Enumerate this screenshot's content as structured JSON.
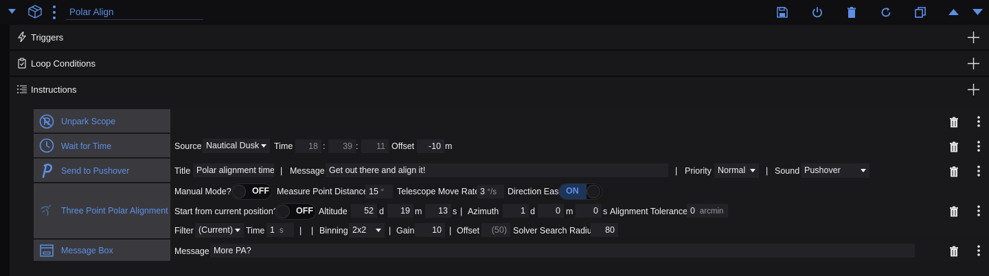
{
  "header": {
    "title": "Polar Align"
  },
  "sections": {
    "triggers": "Triggers",
    "loop_conditions": "Loop Conditions",
    "instructions": "Instructions"
  },
  "items": {
    "unpark": {
      "label": "Unpark Scope"
    },
    "wait": {
      "label": "Wait for Time",
      "source_label": "Source",
      "source_value": "Nautical Dusk",
      "time_label": "Time",
      "hh": "18",
      "mm": "39",
      "ss": "11",
      "colon": ":",
      "offset_label": "Offset",
      "offset_value": "-10",
      "offset_unit": "m"
    },
    "pushover": {
      "label": "Send to Pushover",
      "title_label": "Title",
      "title_value": "Polar alignment time",
      "sep": "|",
      "message_label": "Message",
      "message_value": "Get out there and align it!",
      "priority_label": "Priority",
      "priority_value": "Normal",
      "sound_label": "Sound",
      "sound_value": "Pushover"
    },
    "tppa": {
      "label": "Three Point Polar Alignment",
      "manual_label": "Manual Mode?",
      "manual_state": "OFF",
      "measure_label": "Measure Point Distance",
      "measure_value": "15",
      "measure_unit": "°",
      "move_rate_label": "Telescope Move Rate",
      "move_rate_value": "3",
      "move_rate_unit": "°/s",
      "direction_label": "Direction East",
      "direction_state": "ON",
      "start_label": "Start from current position?",
      "start_state": "OFF",
      "alt_label": "Altitude",
      "alt_d": "52",
      "alt_m": "19",
      "alt_s": "13",
      "az_label": "Azimuth",
      "az_d": "1",
      "az_m": "0",
      "az_s": "0",
      "unit_d": "d",
      "unit_m": "m",
      "unit_s": "s",
      "tol_label": "Alignment Tolerance",
      "tol_value": "0",
      "tol_unit": "arcmin",
      "filter_label": "Filter",
      "filter_value": "(Current)",
      "time_label": "Time",
      "time_value": "1",
      "time_unit": "s",
      "binning_label": "Binning",
      "binning_value": "2x2",
      "gain_label": "Gain",
      "gain_value": "10",
      "offset_label": "Offset",
      "offset_value": "(50)",
      "solver_label": "Solver Search Radius",
      "solver_value": "80"
    },
    "msgbox": {
      "label": "Message Box",
      "message_label": "Message",
      "message_value": "More PA?"
    }
  },
  "colors": {
    "accent": "#5d8fe6",
    "item_label_bg": "#3a3a3e",
    "panel_bg": "#18181b"
  }
}
